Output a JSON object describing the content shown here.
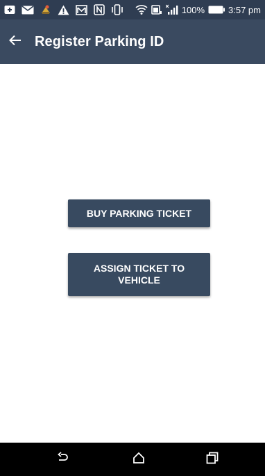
{
  "status_bar": {
    "battery_percent": "100%",
    "time": "3:57 pm",
    "icons": [
      "tv-plus-icon",
      "mail-icon",
      "game-icon",
      "warning-icon",
      "gmail-icon",
      "nfc-icon",
      "vibrate-icon",
      "wifi-icon",
      "battery-saver-icon",
      "signal-icon",
      "battery-icon"
    ]
  },
  "app_bar": {
    "title": "Register Parking ID",
    "back_icon": "arrow-left-icon"
  },
  "actions": {
    "buy_label": "BUY PARKING TICKET",
    "assign_label": "ASSIGN TICKET TO VEHICLE"
  },
  "nav_bar": {
    "icons": [
      "back-icon",
      "home-icon",
      "recents-icon"
    ]
  },
  "colors": {
    "status_bar": "#2f3d52",
    "app_bar": "#3a4a60",
    "button": "#384a60",
    "nav_bar": "#000000"
  }
}
